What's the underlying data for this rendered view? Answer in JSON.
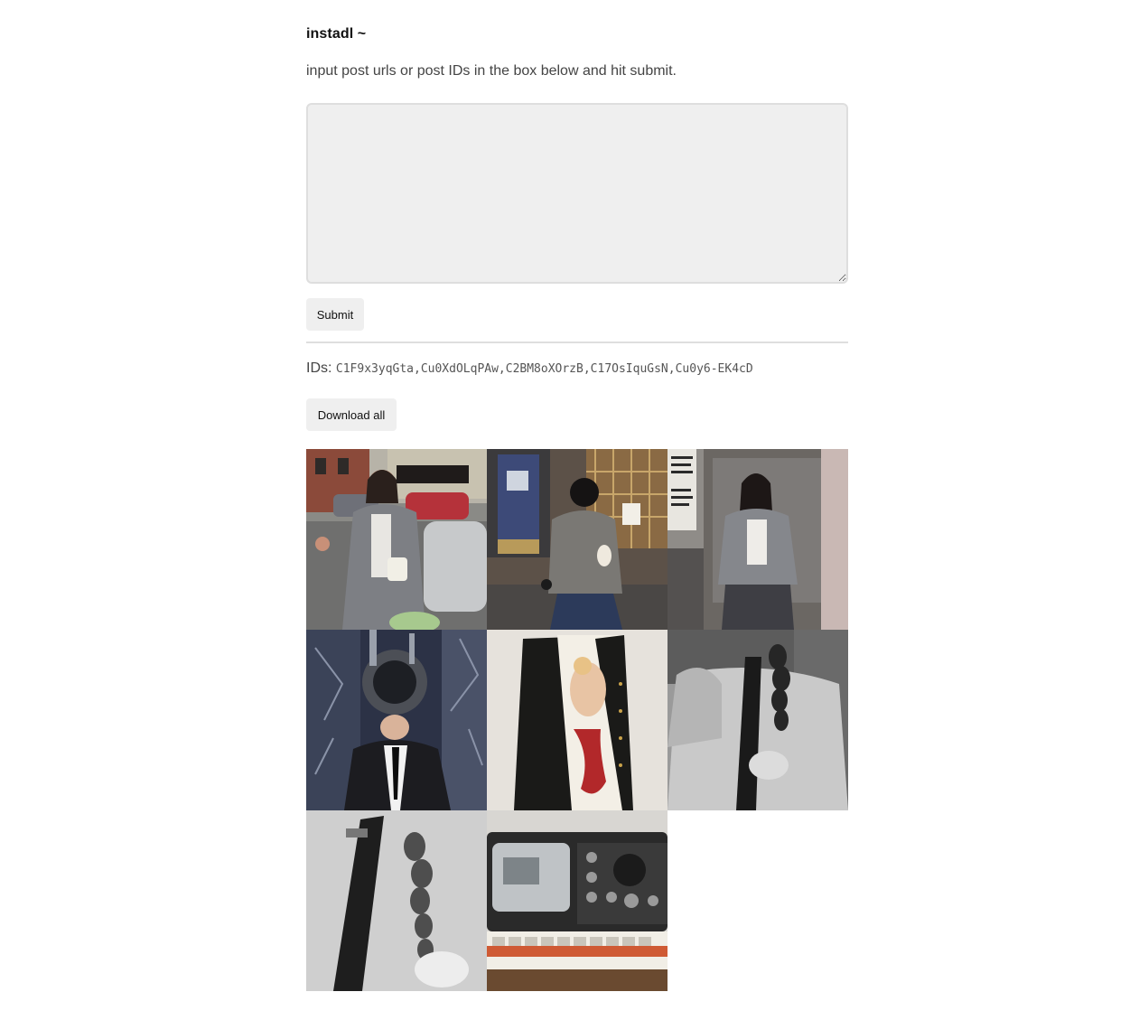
{
  "header": {
    "title": "instadl ~",
    "instructions": "input post urls or post IDs in the box below and hit submit."
  },
  "form": {
    "textarea_value": "",
    "submit_label": "Submit"
  },
  "results": {
    "ids_label": "IDs:",
    "ids_value": "C1F9x3yqGta,Cu0XdOLqPAw,C2BM8oXOrzB,C17OsIquGsN,Cu0y6-EK4cD",
    "download_all_label": "Download all"
  },
  "gallery": {
    "items": [
      {
        "name": "street-photo-woman-grey-blazer-icecream"
      },
      {
        "name": "street-photo-woman-back-blue-door"
      },
      {
        "name": "woman-grey-blazer-storefront"
      },
      {
        "name": "man-suit-mechanical-helmet"
      },
      {
        "name": "black-coat-pinup-lining"
      },
      {
        "name": "bw-braid-rifle-sweater"
      },
      {
        "name": "bw-braid-rifle-closeup"
      },
      {
        "name": "retro-tv-keyboard"
      }
    ]
  }
}
